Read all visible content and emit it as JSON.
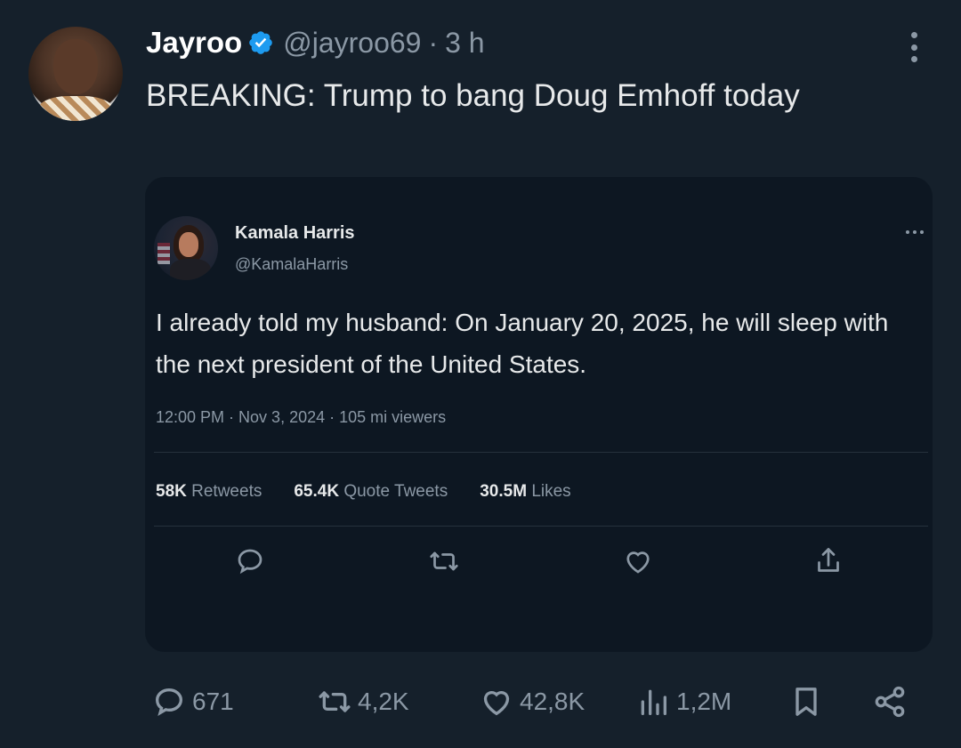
{
  "author": {
    "display_name": "Jayroo",
    "handle": "@jayroo69",
    "separator": "·",
    "time": "3 h",
    "verified_color": "#1d9bf0"
  },
  "tweet": {
    "text": "BREAKING:  Trump to bang Doug Emhoff today"
  },
  "quoted": {
    "display_name": "Kamala Harris",
    "handle": "@KamalaHarris",
    "text": "I already told my husband: On January 20, 2025, he will sleep with the next president of the United States.",
    "meta": "12:00 PM · Nov 3, 2024 · 105 mi viewers",
    "stats": [
      {
        "value": "58K",
        "label": "Retweets"
      },
      {
        "value": "65.4K",
        "label": "Quote Tweets"
      },
      {
        "value": "30.5M",
        "label": "Likes"
      }
    ],
    "actions": [
      "reply-icon",
      "retweet-icon",
      "like-icon",
      "share-icon"
    ]
  },
  "actions": {
    "replies": "671",
    "reposts": "4,2K",
    "likes": "42,8K",
    "views": "1,2M"
  },
  "colors": {
    "background": "#15202b",
    "secondary_text": "#8b98a5",
    "primary_text": "#e7e9ea"
  }
}
